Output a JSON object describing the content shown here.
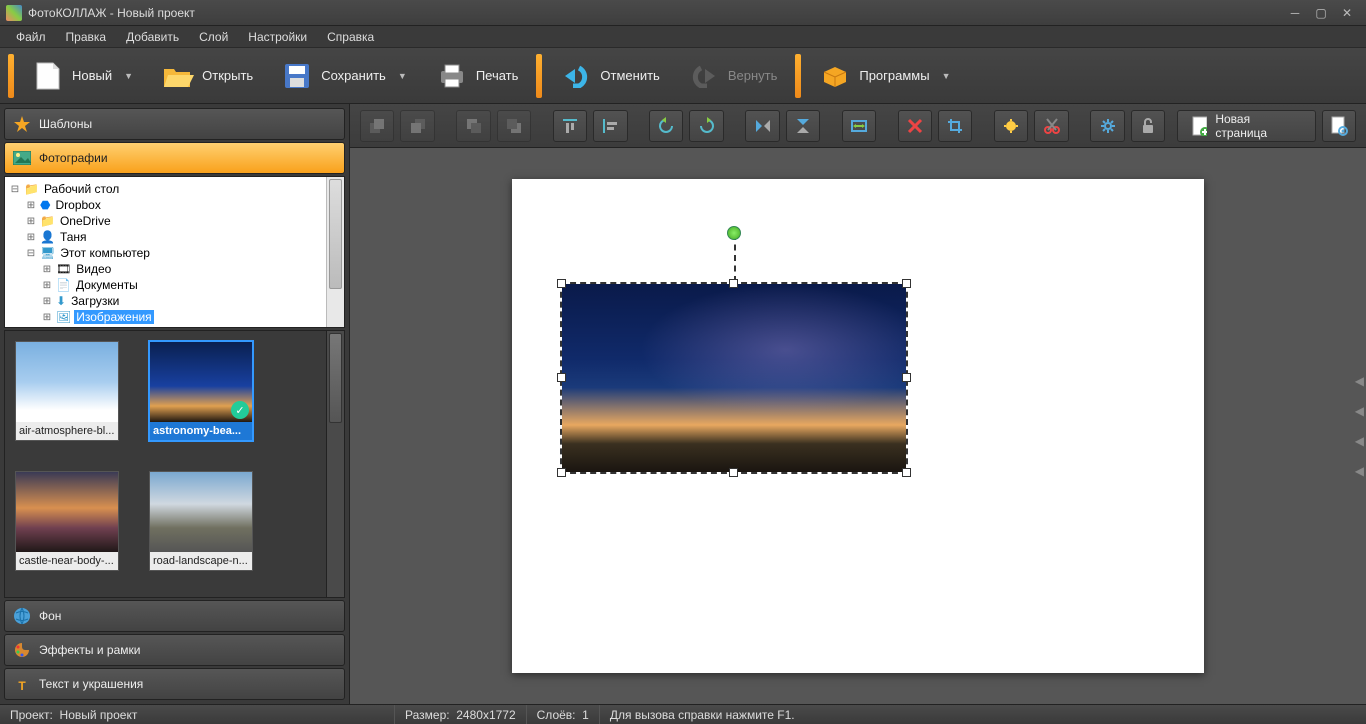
{
  "window": {
    "title": "ФотоКОЛЛАЖ - Новый проект"
  },
  "menus": [
    "Файл",
    "Правка",
    "Добавить",
    "Слой",
    "Настройки",
    "Справка"
  ],
  "toolbar": {
    "new": "Новый",
    "open": "Открыть",
    "save": "Сохранить",
    "print": "Печать",
    "undo": "Отменить",
    "redo": "Вернуть",
    "programs": "Программы"
  },
  "sidebar": {
    "templates": "Шаблоны",
    "photos": "Фотографии",
    "background": "Фон",
    "effects": "Эффекты и рамки",
    "text": "Текст и украшения"
  },
  "tree": {
    "desktop": "Рабочий стол",
    "dropbox": "Dropbox",
    "onedrive": "OneDrive",
    "user": "Таня",
    "computer": "Этот компьютер",
    "video": "Видео",
    "documents": "Документы",
    "downloads": "Загрузки",
    "images": "Изображения"
  },
  "thumbs": {
    "t1": "air-atmosphere-bl...",
    "t2": "astronomy-bea...",
    "t3": "castle-near-body-...",
    "t4": "road-landscape-n..."
  },
  "iconbar": {
    "newpage": "Новая страница"
  },
  "status": {
    "project_label": "Проект:",
    "project_name": "Новый проект",
    "size_label": "Размер:",
    "size_value": "2480x1772",
    "layers_label": "Слоёв:",
    "layers_value": "1",
    "help": "Для вызова справки нажмите F1."
  }
}
